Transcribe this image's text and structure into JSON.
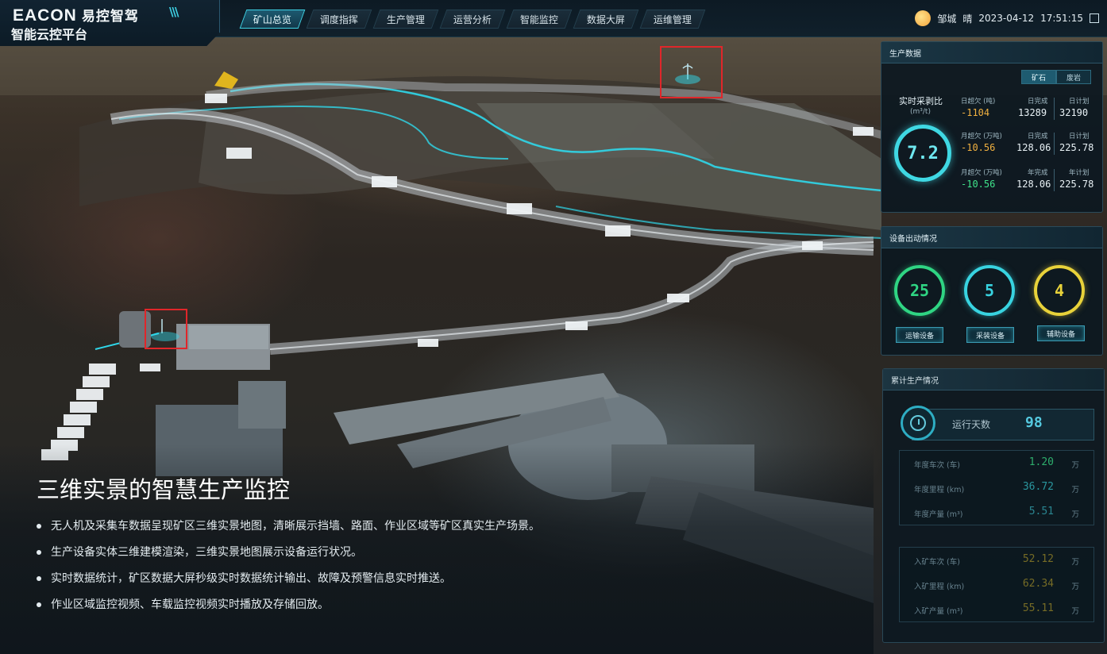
{
  "brand": {
    "logo_en": "EACON",
    "logo_cn": "易控智驾",
    "platform": "智能云控平台"
  },
  "nav": {
    "items": [
      "矿山总览",
      "调度指挥",
      "生产管理",
      "运营分析",
      "智能监控",
      "数据大屏",
      "运维管理"
    ],
    "active": "矿山总览"
  },
  "status": {
    "location": "邹城",
    "weather": "晴",
    "date": "2023-04-12",
    "time": "17:51:15"
  },
  "production": {
    "title": "生产数据",
    "tabs": [
      "矿石",
      "废岩"
    ],
    "ratio_label": "实时采剥比",
    "ratio_unit": "(m³/t)",
    "ratio_value": "7.2",
    "rows": [
      {
        "over_label": "日超欠 (吨)",
        "over": "-1104",
        "done_label": "日完成",
        "done": "13289",
        "plan_label": "日计划",
        "plan": "32190"
      },
      {
        "over_label": "月超欠 (万吨)",
        "over": "-10.56",
        "done_label": "日完成",
        "done": "128.06",
        "plan_label": "日计划",
        "plan": "225.78"
      },
      {
        "over_label": "月超欠 (万吨)",
        "over": "-10.56",
        "done_label": "年完成",
        "done": "128.06",
        "plan_label": "年计划",
        "plan": "225.78"
      }
    ]
  },
  "equipment": {
    "title": "设备出动情况",
    "items": [
      {
        "value": "25",
        "label": "运输设备",
        "color": "#2fd583"
      },
      {
        "value": "5",
        "label": "采装设备",
        "color": "#38d3e0"
      },
      {
        "value": "4",
        "label": "辅助设备",
        "color": "#e8d23a"
      }
    ]
  },
  "cumulative": {
    "title": "累计生产情况",
    "days_label": "运行天数",
    "days_value": "98",
    "group1": [
      {
        "label": "年度车次 (车)",
        "value": "1.20",
        "unit": "万"
      },
      {
        "label": "年度里程 (km)",
        "value": "36.72",
        "unit": "万"
      },
      {
        "label": "年度产量 (m³)",
        "value": "5.51",
        "unit": "万"
      }
    ],
    "group2": [
      {
        "label": "入矿车次 (车)",
        "value": "52.12",
        "unit": "万"
      },
      {
        "label": "入矿里程 (km)",
        "value": "62.34",
        "unit": "万"
      },
      {
        "label": "入矿产量 (m³)",
        "value": "55.11",
        "unit": "万"
      }
    ]
  },
  "overlay": {
    "title": "三维实景的智慧生产监控",
    "bullets": [
      "无人机及采集车数据呈现矿区三维实景地图，清晰展示挡墙、路面、作业区域等矿区真实生产场景。",
      "生产设备实体三维建模渲染，三维实景地图展示设备运行状况。",
      "实时数据统计，矿区数据大屏秒级实时数据统计输出、故障及预警信息实时推送。",
      "作业区域监控视频、车载监控视频实时播放及存储回放。"
    ]
  },
  "colors": {
    "accent": "#3fd3e6",
    "orange": "#f0b040",
    "green": "#3fe28a",
    "marker": "#e0262a"
  }
}
